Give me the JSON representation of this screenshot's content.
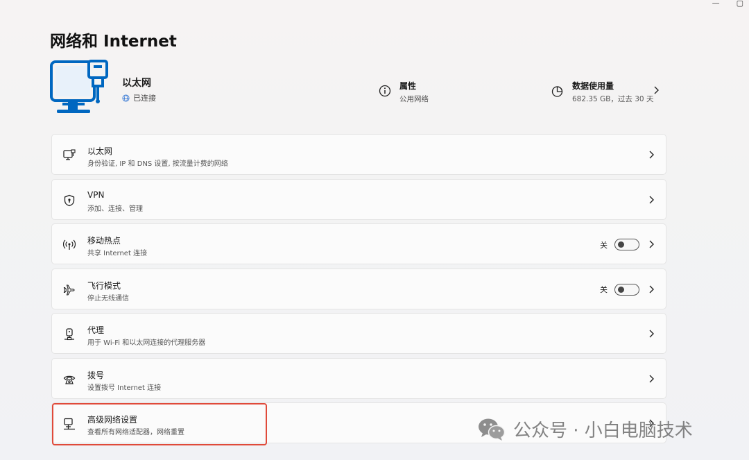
{
  "window": {
    "controls": [
      "—",
      "▢"
    ]
  },
  "page": {
    "title": "网络和 Internet"
  },
  "hero": {
    "name": "以太网",
    "status": "已连接",
    "properties_title": "属性",
    "properties_sub": "公用网络",
    "data_title": "数据使用量",
    "data_sub": "682.35 GB，过去 30 天"
  },
  "items": [
    {
      "title": "以太网",
      "sub": "身份验证, IP 和 DNS 设置, 按流量计费的网络",
      "icon": "ethernet-icon"
    },
    {
      "title": "VPN",
      "sub": "添加、连接、管理",
      "icon": "vpn-shield-icon"
    },
    {
      "title": "移动热点",
      "sub": "共享 Internet 连接",
      "icon": "hotspot-icon",
      "toggle": "关",
      "toggle_on": false
    },
    {
      "title": "飞行模式",
      "sub": "停止无线通信",
      "icon": "airplane-icon",
      "toggle": "关",
      "toggle_on": false
    },
    {
      "title": "代理",
      "sub": "用于 Wi-Fi 和以太网连接的代理服务器",
      "icon": "proxy-icon"
    },
    {
      "title": "拨号",
      "sub": "设置拨号 Internet 连接",
      "icon": "dialup-icon"
    },
    {
      "title": "高级网络设置",
      "sub": "查看所有网络适配器，网络重置",
      "icon": "advanced-network-icon"
    }
  ],
  "watermark": {
    "text": "公众号 · 小白电脑技术"
  },
  "colors": {
    "accent": "#0067c0",
    "highlight_border": "#e04a3a"
  }
}
